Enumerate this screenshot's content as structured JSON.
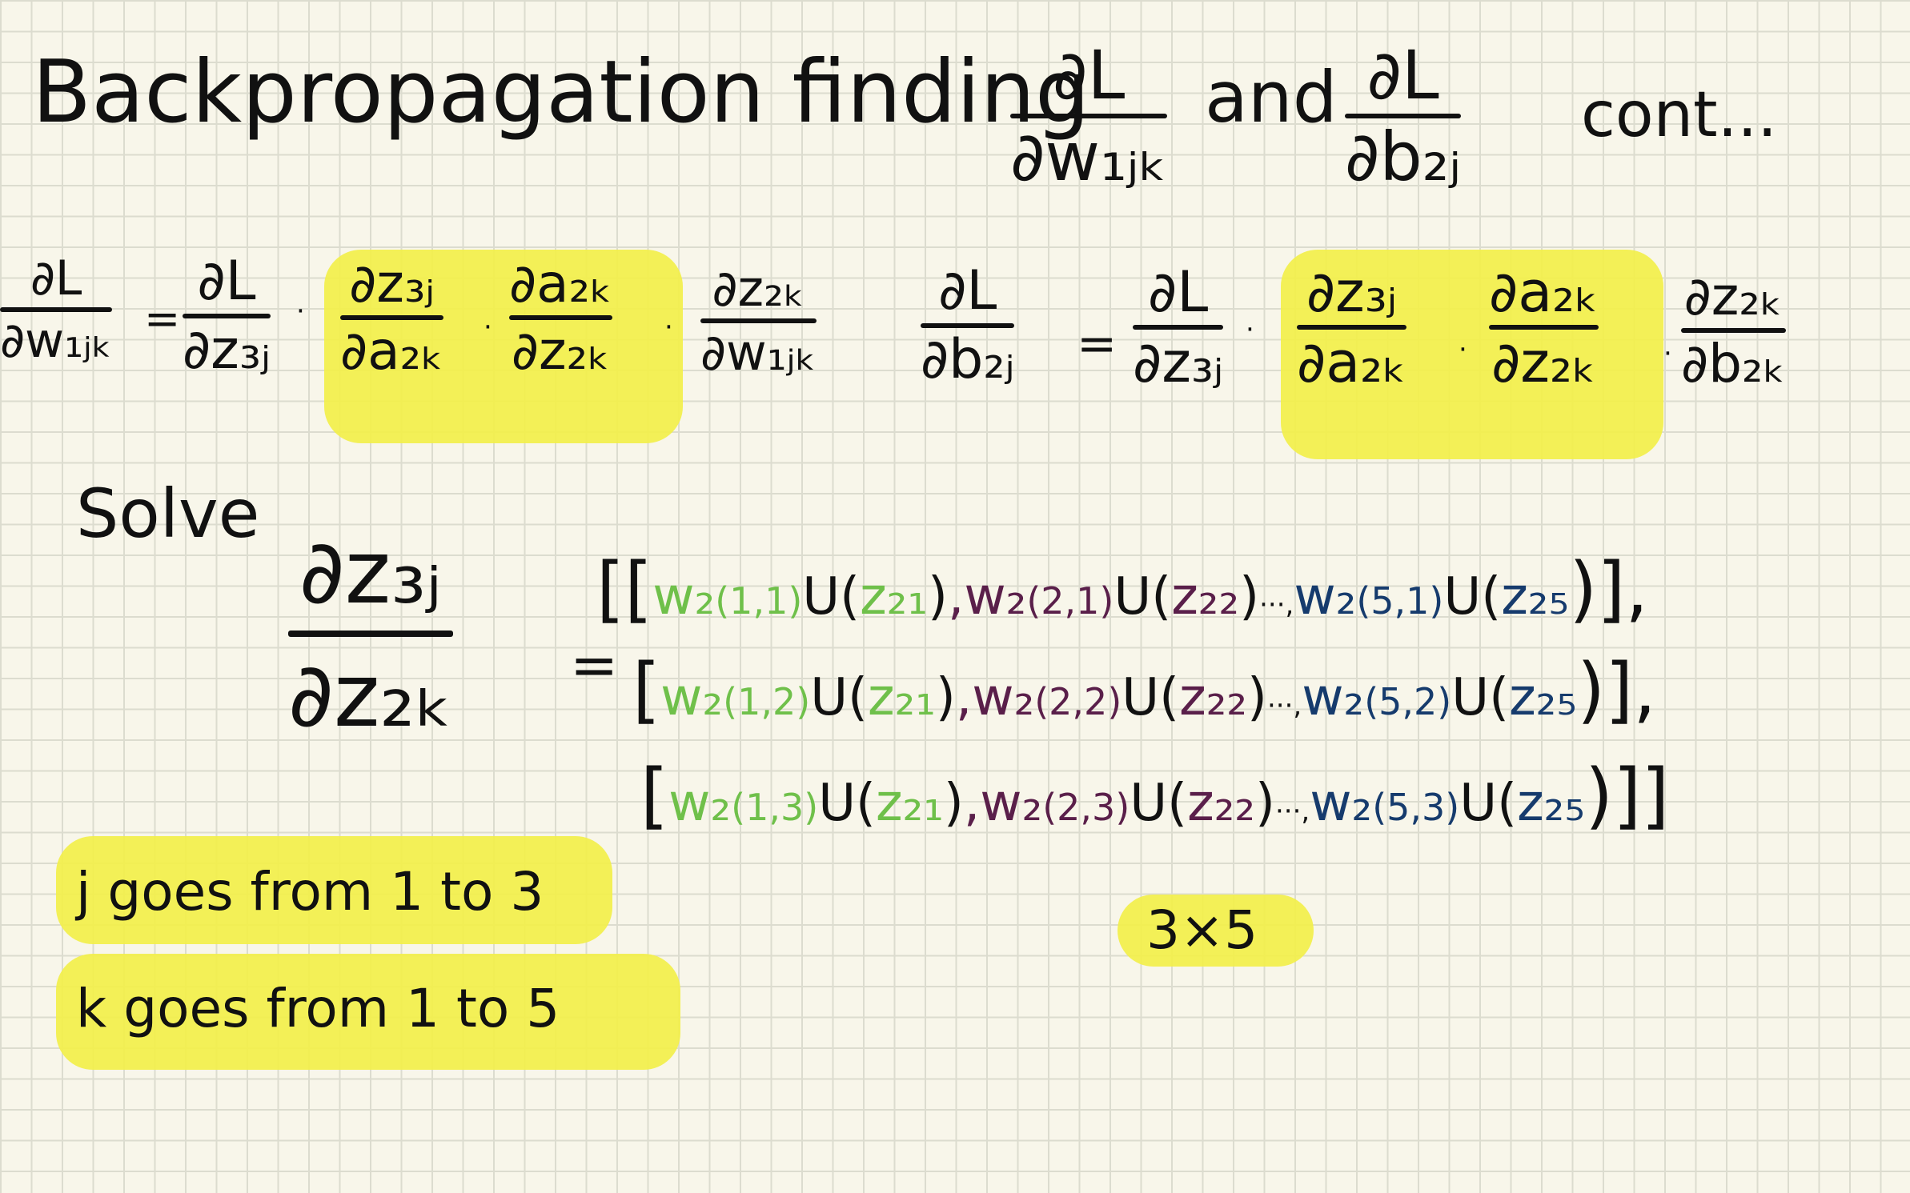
{
  "title": {
    "lead": "Backpropagation finding",
    "frac1_num": "∂L",
    "frac1_den": "∂w₁ⱼₖ",
    "and": "and",
    "frac2_num": "∂L",
    "frac2_den": "∂b₂ⱼ",
    "tail": "cont..."
  },
  "chain_w": {
    "lhs_num": "∂L",
    "lhs_den": "∂w₁ⱼₖ",
    "eq": "=",
    "f1_num": "∂L",
    "f1_den": "∂z₃ⱼ",
    "f2_num": "∂z₃ⱼ",
    "f2_den": "∂a₂ₖ",
    "f3_num": "∂a₂ₖ",
    "f3_den": "∂z₂ₖ",
    "f4_num": "∂z₂ₖ",
    "f4_den": "∂w₁ⱼₖ",
    "mul": "·"
  },
  "chain_b": {
    "lhs_num": "∂L",
    "lhs_den": "∂b₂ⱼ",
    "eq": "=",
    "f1_num": "∂L",
    "f1_den": "∂z₃ⱼ",
    "f2_num": "∂z₃ⱼ",
    "f2_den": "∂a₂ₖ",
    "f3_num": "∂a₂ₖ",
    "f3_den": "∂z₂ₖ",
    "f4_num": "∂z₂ₖ",
    "f4_den": "∂b₂ₖ",
    "mul": "·"
  },
  "solve": {
    "label": "Solve",
    "num": "∂z₃ⱼ",
    "den": "∂z₂ₖ",
    "eq": "="
  },
  "matrix": {
    "rows": [
      {
        "open": "[[",
        "a_w": "w₂",
        "a_idx": "(1,1)",
        "a_u": "U(",
        "a_z": "z₂₁",
        "a_close": ")",
        "b_w": ",w₂",
        "b_idx": "(2,1)",
        "b_u": "U(",
        "b_z": "z₂₂",
        "b_close": ")",
        "dots": "···,",
        "c_w": "w₂",
        "c_idx": "(5,1)",
        "c_u": "U(",
        "c_z": "z₂₅",
        "c_close": ")],",
        "end": ""
      },
      {
        "open": "[",
        "a_w": "w₂",
        "a_idx": "(1,2)",
        "a_u": "U(",
        "a_z": "z₂₁",
        "a_close": ")",
        "b_w": ",w₂",
        "b_idx": "(2,2)",
        "b_u": "U(",
        "b_z": "z₂₂",
        "b_close": ")",
        "dots": "···,",
        "c_w": "w₂",
        "c_idx": "(5,2)",
        "c_u": "U(",
        "c_z": "z₂₅",
        "c_close": ")],",
        "end": ""
      },
      {
        "open": "[",
        "a_w": "w₂",
        "a_idx": "(1,3)",
        "a_u": "U(",
        "a_z": "z₂₁",
        "a_close": ")",
        "b_w": ",w₂",
        "b_idx": "(2,3)",
        "b_u": "U(",
        "b_z": "z₂₂",
        "b_close": ")",
        "dots": "···,",
        "c_w": "w₂",
        "c_idx": "(5,3)",
        "c_u": "U(",
        "c_z": "z₂₅",
        "c_close": ")]]",
        "end": ""
      }
    ],
    "shape": "3×5"
  },
  "notes": {
    "j_range": "j goes from 1 to 3",
    "k_range": "k goes from 1 to 5"
  },
  "colors": {
    "highlight": "#f2ef4a",
    "green": "#6fc04a",
    "purple": "#5a1f4a",
    "navy": "#163b6d",
    "ink": "#111111",
    "paper": "#f8f6ea"
  }
}
